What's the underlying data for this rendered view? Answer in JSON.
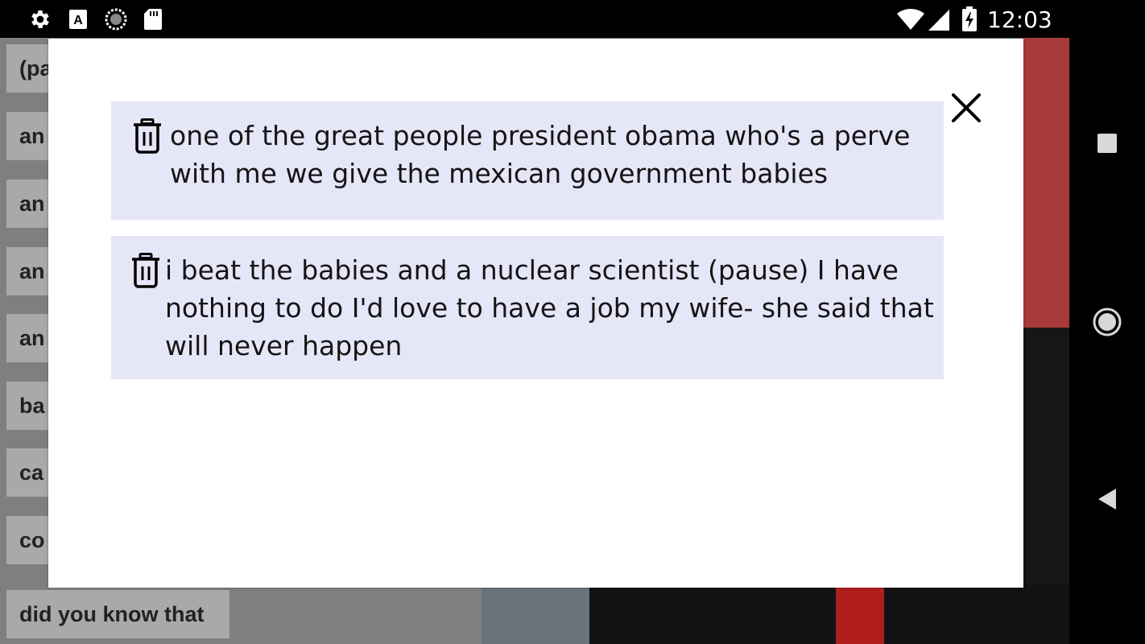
{
  "status_bar": {
    "time": "12:03",
    "left_icons": [
      "settings-icon",
      "font-a-icon",
      "sync-progress-icon",
      "sd-card-icon"
    ],
    "right_icons": [
      "wifi-icon",
      "cell-signal-icon",
      "battery-charging-icon"
    ]
  },
  "background_list": {
    "items": [
      "(pa",
      "an",
      "an",
      "an",
      "an",
      "ba",
      "ca",
      "co",
      "did you know that"
    ]
  },
  "dialog": {
    "close_icon": "close-icon",
    "entries": [
      {
        "line1": "one of the great people president obama who's a perve",
        "line2": "with me we give the mexican government babies",
        "line3": "",
        "icon": "trash-icon"
      },
      {
        "line1": "i beat the babies and a nuclear scientist (pause) I have",
        "line2": "nothing to do I'd love to have a job my wife- she said that",
        "line3": "will never happen",
        "icon": "trash-icon"
      }
    ]
  },
  "nav_bar": {
    "buttons": [
      "recents-square-icon",
      "home-circle-icon",
      "back-triangle-icon"
    ]
  },
  "colors": {
    "entry_background": "#e6e6f9",
    "chip_background": "#a9a9a9",
    "scrim_background": "#7f7f7f"
  }
}
